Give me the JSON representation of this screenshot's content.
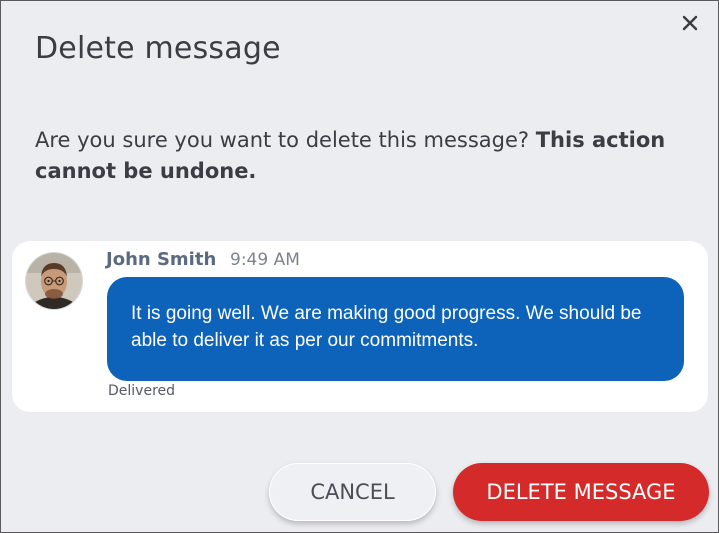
{
  "dialog": {
    "title": "Delete message",
    "prompt_text": "Are you sure you want to delete this message? ",
    "prompt_emphasis": "This action cannot be undone.",
    "close_icon": "close-icon"
  },
  "message": {
    "sender": "John Smith",
    "time": "9:49 AM",
    "text": "It is going well. We are making good progress. We should be able to deliver it as per our commitments.",
    "status": "Delivered",
    "bubble_color": "#0d63ba"
  },
  "actions": {
    "cancel_label": "CANCEL",
    "delete_label": "DELETE MESSAGE",
    "delete_color": "#d42a2a"
  }
}
